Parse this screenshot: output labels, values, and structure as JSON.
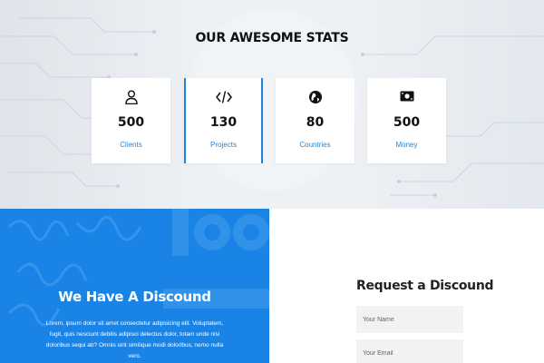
{
  "stats": {
    "title": "OUR AWESOME STATS",
    "items": [
      {
        "value": "500",
        "label": "Clients",
        "icon": "user-icon"
      },
      {
        "value": "130",
        "label": "Projects",
        "icon": "code-icon"
      },
      {
        "value": "80",
        "label": "Countries",
        "icon": "globe-icon"
      },
      {
        "value": "500",
        "label": "Money",
        "icon": "money-icon"
      }
    ]
  },
  "discount": {
    "title": "We Have A Discound",
    "text": "Lorem, ipsum dolor sit amet consectetur adipisicing elit. Voluptatem, fugit, quis nesciunt debitis adipisci delectus dolor, totam unde nisi doloribus sequi ab? Omnis sint similique modi doloribus, nemo nulla vero."
  },
  "request": {
    "title": "Request a Discound",
    "name_placeholder": "Your Name",
    "email_placeholder": "Your Email"
  },
  "colors": {
    "accent": "#1e86e0",
    "panel_blue": "#1a84e6",
    "stats_bg": "#eef1f4"
  }
}
